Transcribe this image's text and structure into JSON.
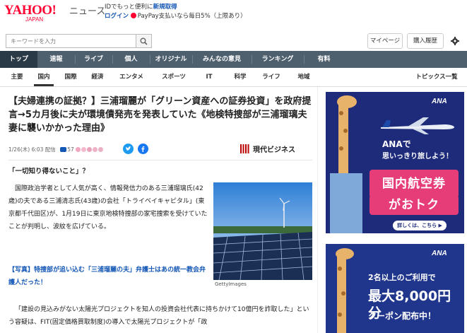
{
  "header": {
    "logo_main": "YAHOO!",
    "logo_sub": "JAPAN",
    "logo_news": "ニュース",
    "promo_line1": "IDでもっと便利に",
    "promo_line1_link": "新規取得",
    "promo_login": "ログイン",
    "promo_paypay": "PayPay支払いなら毎日5%（上限あり）",
    "search_placeholder": "キーワードを入力",
    "mypage": "マイページ",
    "history": "購入履歴"
  },
  "main_nav": [
    "トップ",
    "速報",
    "ライブ",
    "個人",
    "オリジナル",
    "みんなの意見",
    "ランキング",
    "有料"
  ],
  "sub_nav": [
    "主要",
    "国内",
    "国際",
    "経済",
    "エンタメ",
    "スポーツ",
    "IT",
    "科学",
    "ライフ",
    "地域"
  ],
  "sub_nav_topics": "トピックス一覧",
  "article": {
    "headline": "【夫婦連携の証拠？】三浦瑠麗が「グリーン資産への証券投資」を政府提言→5カ月後に夫が環境債発売を発表していた《地検特捜部が三浦瑠璃夫妻に襲いかかった理由》",
    "date": "1/26(木) 6:03 配信",
    "comment_count": "57",
    "publisher": "現代ビジネス",
    "subhead": "「一切知り得ないこと」？",
    "para1": "国際政治学者として人気が高く、情報発信力のある三浦瑠璃氏(42歳)の夫である三浦清志氏(43歳)の会社「トライベイキャピタル」(東京都千代田区)が、1月19日に東京地検特捜部の家宅捜索を受けていたことが判明し、波紋を広げている。",
    "related_link": "【写真】特捜部が追い込む「三浦瑠麗の夫」弁護士はあの統一教会弁護人だった！",
    "photo_caption": "GettyImages",
    "para2": "「建設の見込みがない太陽光プロジェクトを知人の投資会社代表に持ちかけて10億円を詐取した」という容疑は、FIT(固定価格買取制度)の導入で太陽光プロジェクトが「政"
  },
  "ads": {
    "ad1_line1": "ANAで",
    "ad1_line2": "思いっきり旅しよう！",
    "ad1_box1": "国内航空券",
    "ad1_box2": "がおトク",
    "ad1_more": "詳しくは、こちら ▶",
    "ad2_line1": "2名以上のご利用で",
    "ad2_line2": "最大8,000円分",
    "ad2_line3": "クーポン配布中！",
    "brand": "ANA"
  },
  "colors": {
    "yahoo_red": "#ff0033",
    "nav_bg": "#4e5f6e",
    "nav_active": "#2b3a47",
    "link_blue": "#1457b5",
    "ad_navy": "#1e2b7a"
  }
}
